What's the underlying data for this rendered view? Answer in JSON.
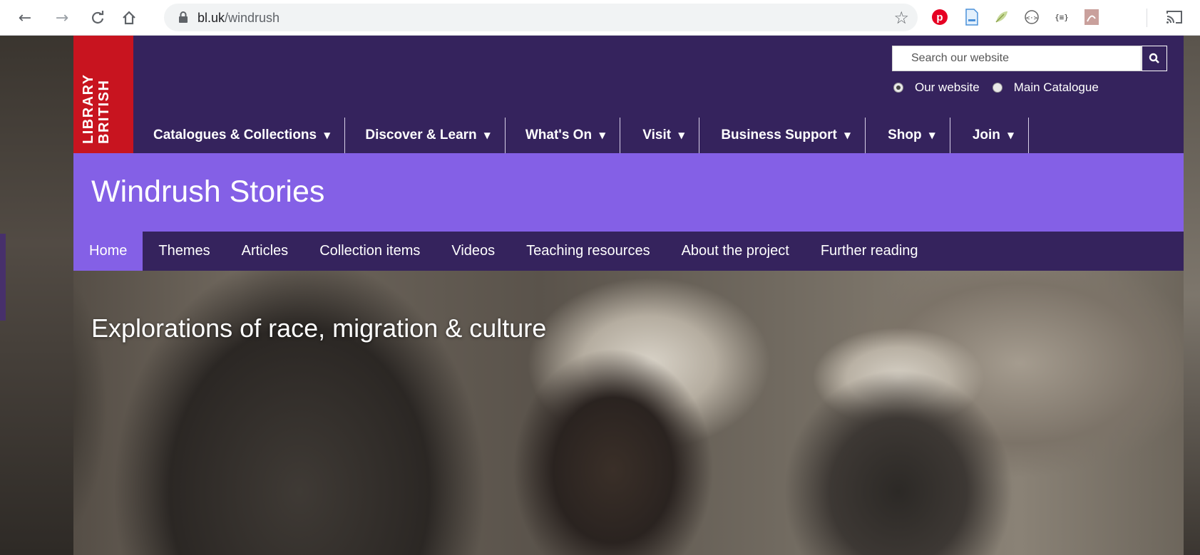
{
  "browser": {
    "back_icon": "arrow-left-icon",
    "forward_icon": "arrow-right-icon",
    "reload_icon": "reload-icon",
    "home_icon": "home-icon",
    "url_host": "bl.uk",
    "url_path": "/windrush",
    "extensions": [
      "pinterest-icon",
      "document-icon",
      "leaf-icon",
      "code-icon",
      "json-icon",
      "pdf-icon",
      "cast-icon"
    ]
  },
  "header": {
    "logo_line1": "BRITISH",
    "logo_line2": "LIBRARY",
    "search_placeholder": "Search our website",
    "radio_options": [
      {
        "label": "Our website",
        "checked": true
      },
      {
        "label": "Main Catalogue",
        "checked": false
      }
    ],
    "main_nav": [
      {
        "label": "Catalogues & Collections"
      },
      {
        "label": "Discover & Learn"
      },
      {
        "label": "What's On"
      },
      {
        "label": "Visit"
      },
      {
        "label": "Business Support"
      },
      {
        "label": "Shop"
      },
      {
        "label": "Join"
      }
    ]
  },
  "title": "Windrush Stories",
  "sub_nav": [
    {
      "label": "Home",
      "active": true
    },
    {
      "label": "Themes",
      "active": false
    },
    {
      "label": "Articles",
      "active": false
    },
    {
      "label": "Collection items",
      "active": false
    },
    {
      "label": "Videos",
      "active": false
    },
    {
      "label": "Teaching resources",
      "active": false
    },
    {
      "label": "About the project",
      "active": false
    },
    {
      "label": "Further reading",
      "active": false
    }
  ],
  "hero": {
    "tagline": "Explorations of race, migration & culture"
  },
  "colors": {
    "header_bg": "#35235d",
    "title_bg": "#8460e6",
    "logo_red": "#c8141f"
  }
}
